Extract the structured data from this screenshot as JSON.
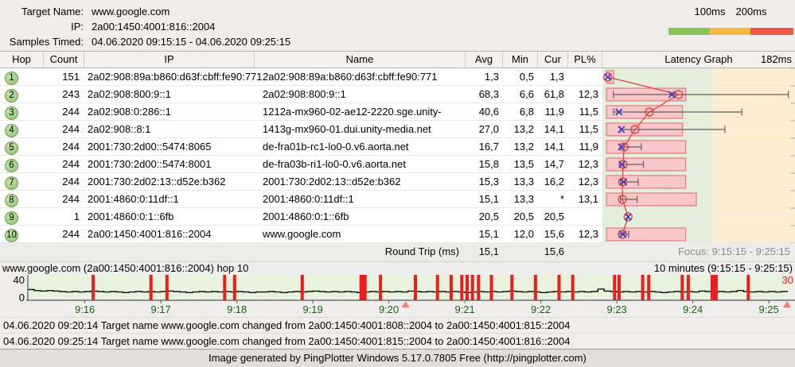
{
  "header": {
    "target_name_label": "Target Name:",
    "target_name": "www.google.com",
    "ip_label": "IP:",
    "ip": "2a00:1450:4001:816::2004",
    "samples_label": "Samples Timed:",
    "samples": "04.06.2020 09:15:15 - 04.06.2020 09:25:15",
    "legend": {
      "labels": [
        "100ms",
        "200ms"
      ],
      "colors": [
        "#8ec255",
        "#f6b845",
        "#f2584a"
      ]
    }
  },
  "table": {
    "columns": [
      "Hop",
      "Count",
      "IP",
      "Name",
      "Avg",
      "Min",
      "Cur",
      "PL%",
      "Latency Graph"
    ],
    "graph_scale_label": "182ms",
    "rows": [
      {
        "hop": "1",
        "count": "151",
        "ip": "2a02:908:89a:b860:d63f:cbff:fe90:771",
        "name": "2a02:908:89a:b860:d63f:cbff:fe90:771",
        "avg": "1,3",
        "min": "0,5",
        "cur": "1,3",
        "pl": ""
      },
      {
        "hop": "2",
        "count": "243",
        "ip": "2a02:908:800:9::1",
        "name": "2a02:908:800:9::1",
        "avg": "68,3",
        "min": "6,6",
        "cur": "61,8",
        "pl": "12,3"
      },
      {
        "hop": "3",
        "count": "244",
        "ip": "2a02:908:0:286::1",
        "name": "1212a-mx960-02-ae12-2220.sge.unity-",
        "avg": "40,6",
        "min": "6,8",
        "cur": "11,9",
        "pl": "11,5"
      },
      {
        "hop": "4",
        "count": "244",
        "ip": "2a02:908::8:1",
        "name": "1413g-mx960-01.dui.unity-media.net",
        "avg": "27,0",
        "min": "13,2",
        "cur": "14,1",
        "pl": "11,5"
      },
      {
        "hop": "5",
        "count": "244",
        "ip": "2001:730:2d00::5474:8065",
        "name": "de-fra01b-rc1-lo0-0.v6.aorta.net",
        "avg": "16,7",
        "min": "13,2",
        "cur": "14,1",
        "pl": "11,9"
      },
      {
        "hop": "6",
        "count": "244",
        "ip": "2001:730:2d00::5474:8001",
        "name": "de-fra03b-ri1-lo0-0.v6.aorta.net",
        "avg": "15,8",
        "min": "13,5",
        "cur": "14,7",
        "pl": "12,3"
      },
      {
        "hop": "7",
        "count": "244",
        "ip": "2001:730:2d02:13::d52e:b362",
        "name": "2001:730:2d02:13::d52e:b362",
        "avg": "15,3",
        "min": "13,3",
        "cur": "16,2",
        "pl": "12,3"
      },
      {
        "hop": "8",
        "count": "244",
        "ip": "2001:4860:0:11df::1",
        "name": "2001:4860:0:11df::1",
        "avg": "15,1",
        "min": "13,3",
        "cur": "*",
        "pl": "13,1"
      },
      {
        "hop": "9",
        "count": "1",
        "ip": "2001:4860:0:1::6fb",
        "name": "2001:4860:0:1::6fb",
        "avg": "20,5",
        "min": "20,5",
        "cur": "20,5",
        "pl": ""
      },
      {
        "hop": "10",
        "count": "244",
        "ip": "2a00:1450:4001:816::2004",
        "name": "www.google.com",
        "avg": "15,1",
        "min": "12,0",
        "cur": "15,6",
        "pl": "12,3"
      }
    ],
    "round_trip": {
      "label": "Round Trip (ms)",
      "avg": "15,1",
      "cur": "15,6",
      "focus": "Focus: 9:15:15 - 9:25:15"
    }
  },
  "chart_data": [
    {
      "id": "hop-latency-graph",
      "type": "scatter",
      "x_unit": "ms",
      "x_max": 182,
      "zone_boundary_ms": 100,
      "zone_colors": {
        "low": "#e3efda",
        "mid": "#fcecd1"
      },
      "marker_legend": {
        "blue_x": "current",
        "red_circle": "average",
        "black_line": "min-max range",
        "pink_bar": "latency bar"
      },
      "rows": [
        {
          "hop": 1,
          "cur": 1.3,
          "avg": 1.3,
          "bar": 7,
          "min": null,
          "max": null
        },
        {
          "hop": 2,
          "cur": 61.8,
          "avg": 68.3,
          "bar": 75,
          "min": 6.6,
          "max": 172
        },
        {
          "hop": 3,
          "cur": 11.9,
          "avg": 40.6,
          "bar": 72,
          "min": 6.8,
          "max": 128
        },
        {
          "hop": 4,
          "cur": 14.1,
          "avg": 27.0,
          "bar": 72,
          "min": 13.2,
          "max": 112
        },
        {
          "hop": 5,
          "cur": 14.1,
          "avg": 16.7,
          "bar": 75,
          "min": 13.2,
          "max": 33
        },
        {
          "hop": 6,
          "cur": 14.7,
          "avg": 15.8,
          "bar": 75,
          "min": 13.5,
          "max": 35
        },
        {
          "hop": 7,
          "cur": 16.2,
          "avg": 15.3,
          "bar": 75,
          "min": 13.3,
          "max": 30
        },
        {
          "hop": 8,
          "cur": null,
          "avg": 15.1,
          "bar": 85,
          "min": 13.3,
          "max": 29
        },
        {
          "hop": 9,
          "cur": 20.5,
          "avg": 20.5,
          "bar": null,
          "min": null,
          "max": null
        },
        {
          "hop": 10,
          "cur": 15.6,
          "avg": 15.1,
          "bar": 75,
          "min": 12.0,
          "max": 21
        }
      ]
    },
    {
      "id": "timeline-graph",
      "type": "line",
      "title": "www.google.com (2a00:1450:4001:816::2004) hop 10",
      "duration_label": "10 minutes (9:15:15 - 9:25:15)",
      "y_axis_labels": [
        "40",
        "0"
      ],
      "y_max_visible": 40,
      "current_value_label": "30",
      "x_tick_labels": [
        "9:16",
        "9:17",
        "9:18",
        "9:19",
        "9:20",
        "9:21",
        "9:22",
        "9:23",
        "9:24",
        "9:25"
      ],
      "x_tick_fracs": [
        0.075,
        0.175,
        0.275,
        0.375,
        0.475,
        0.575,
        0.675,
        0.775,
        0.875,
        0.975
      ],
      "samples_ms": [
        20,
        18,
        17,
        18,
        17,
        16,
        15,
        16,
        15,
        16,
        17,
        16,
        15,
        16,
        15,
        14,
        15,
        16,
        15,
        16,
        15,
        16,
        17,
        16,
        15,
        14,
        15,
        16,
        15,
        16,
        15,
        16,
        15,
        16,
        15,
        14,
        15,
        15,
        16,
        15,
        14,
        15,
        16,
        15,
        16,
        17,
        16,
        15,
        16,
        15,
        16,
        15,
        14,
        15,
        16,
        15,
        16,
        15,
        16,
        15,
        17,
        16,
        15,
        16,
        15,
        16,
        15,
        16,
        15,
        14,
        15,
        16,
        15,
        16,
        15,
        16,
        17,
        16,
        15,
        16,
        15,
        14,
        15,
        16,
        15,
        16,
        15,
        16,
        15,
        16,
        21,
        17,
        16,
        15,
        16,
        15,
        16,
        15,
        16,
        15,
        14,
        15,
        16,
        15,
        16,
        15,
        17,
        16,
        15,
        16,
        15,
        16,
        18,
        16,
        15,
        16,
        15,
        16,
        15,
        16
      ],
      "loss_bars": [
        [
          0.086,
          4
        ],
        [
          0.162,
          4
        ],
        [
          0.183,
          4
        ],
        [
          0.259,
          4
        ],
        [
          0.272,
          4
        ],
        [
          0.361,
          4
        ],
        [
          0.441,
          9
        ],
        [
          0.464,
          4
        ],
        [
          0.51,
          4
        ],
        [
          0.539,
          4
        ],
        [
          0.557,
          4
        ],
        [
          0.571,
          4
        ],
        [
          0.578,
          4
        ],
        [
          0.585,
          4
        ],
        [
          0.593,
          4
        ],
        [
          0.61,
          4
        ],
        [
          0.637,
          4
        ],
        [
          0.668,
          4
        ],
        [
          0.699,
          4
        ],
        [
          0.717,
          4
        ],
        [
          0.772,
          4
        ],
        [
          0.778,
          4
        ],
        [
          0.809,
          4
        ],
        [
          0.817,
          4
        ],
        [
          0.861,
          4
        ],
        [
          0.869,
          4
        ],
        [
          0.903,
          9
        ],
        [
          0.948,
          4
        ]
      ],
      "event_marker_fracs": [
        0.497,
        0.999
      ],
      "colors": {
        "plot_bg": "#e7f2df",
        "line": "#111111",
        "loss_bar": "#ee1c1c",
        "tick_label": "#156415",
        "current_label": "#e02020",
        "event_marker": "#ef8274"
      }
    }
  ],
  "log": {
    "lines": [
      "04.06.2020 09:20:14 Target name www.google.com changed from 2a00:1450:4001:808::2004 to 2a00:1450:4001:815::2004",
      "04.06.2020 09:25:14 Target name www.google.com changed from 2a00:1450:4001:815::2004 to 2a00:1450:4001:816::2004"
    ]
  },
  "footer": {
    "text": "Image generated by PingPlotter Windows 5.17.0.7805 Free (http://pingplotter.com)"
  }
}
